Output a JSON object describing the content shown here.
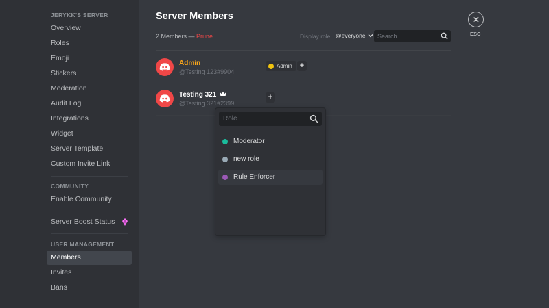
{
  "sidebar": {
    "server_header": "JERYKK'S SERVER",
    "server_items": [
      "Overview",
      "Roles",
      "Emoji",
      "Stickers",
      "Moderation",
      "Audit Log",
      "Integrations",
      "Widget",
      "Server Template",
      "Custom Invite Link"
    ],
    "community_header": "COMMUNITY",
    "community_item": "Enable Community",
    "boost_item": "Server Boost Status",
    "user_mgmt_header": "USER MANAGEMENT",
    "members_item": "Members",
    "invites_item": "Invites",
    "bans_item": "Bans"
  },
  "main": {
    "title": "Server Members",
    "member_count": "2 Members — ",
    "prune_label": "Prune",
    "display_role_label": "Display role:",
    "display_role_value": "@everyone",
    "search_placeholder": "Search"
  },
  "members": [
    {
      "name": "Admin",
      "tag": "@Testing 123#9904",
      "name_color": "#faa61a",
      "role": "Admin",
      "role_color": "#f1c40f",
      "add_label": "+"
    },
    {
      "name": "Testing 321",
      "tag": "@Testing 321#2399",
      "name_color": "#ffffff",
      "add_label": "+"
    }
  ],
  "role_popover": {
    "search_placeholder": "Role",
    "options": [
      {
        "label": "Moderator",
        "color": "#1abc9c"
      },
      {
        "label": "new role",
        "color": "#99aab5"
      },
      {
        "label": "Rule Enforcer",
        "color": "#9b59b6"
      }
    ]
  },
  "close": {
    "esc_label": "ESC"
  },
  "icons": {
    "avatar": "discord-logo-icon",
    "owner": "crown-icon",
    "search": "search-icon",
    "boost": "boost-gem-icon",
    "close": "close-icon",
    "dropdown": "chevron-down-icon"
  },
  "colors": {
    "accent_red": "#f04747",
    "background": "#36393f",
    "sidebar": "#2f3136",
    "boost_pink": "#ff73fa"
  }
}
